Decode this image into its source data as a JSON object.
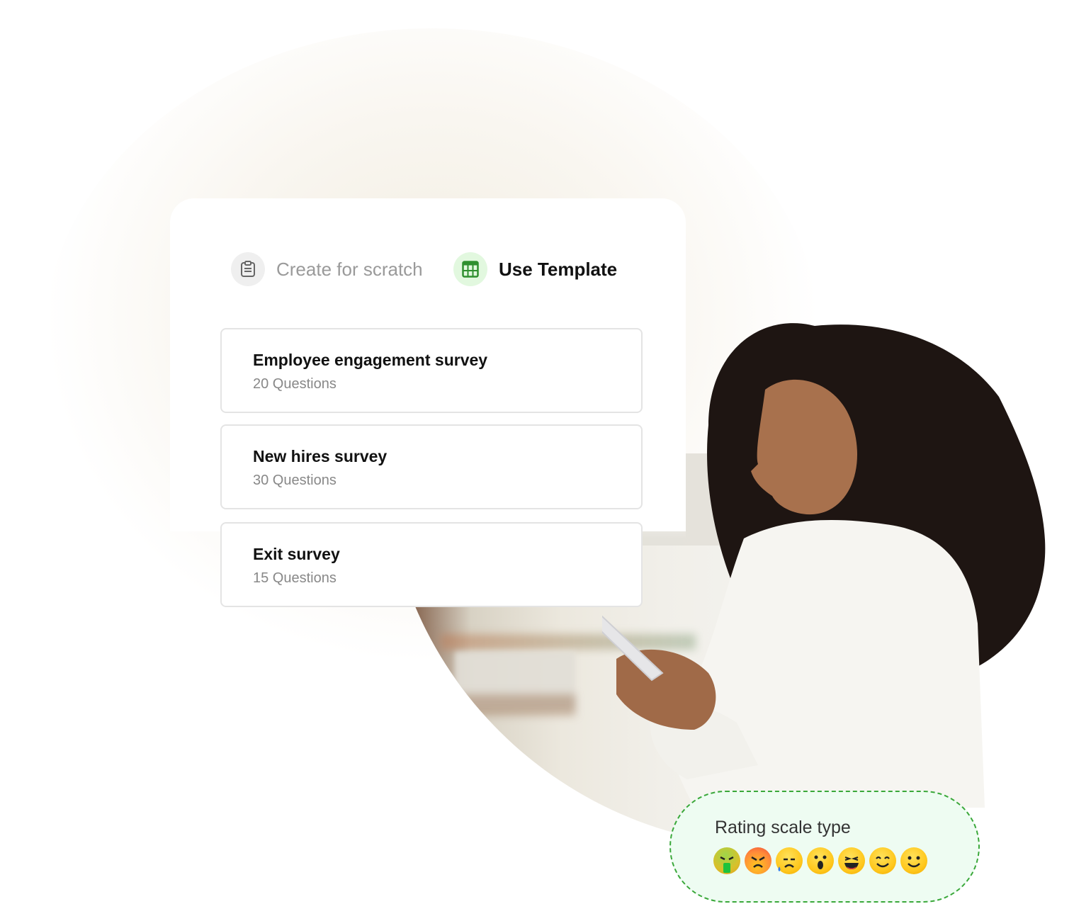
{
  "tabs": [
    {
      "label": "Create for scratch",
      "icon": "clipboard-icon",
      "active": false
    },
    {
      "label": "Use Template",
      "icon": "table-grid-icon",
      "active": true
    }
  ],
  "templates": [
    {
      "title": "Employee engagement survey",
      "questions": "20 Questions"
    },
    {
      "title": "New hires survey",
      "questions": "30 Questions"
    },
    {
      "title": "Exit survey",
      "questions": "15 Questions"
    }
  ],
  "rating": {
    "title": "Rating scale type",
    "emojis": [
      "nauseated-face-icon",
      "angry-face-icon",
      "sad-tear-face-icon",
      "surprised-face-icon",
      "grinning-face-icon",
      "smiling-eyes-face-icon",
      "slight-smile-face-icon"
    ]
  },
  "colors": {
    "accent": "#3aa83a",
    "active_icon_bg": "#e2f8df",
    "rating_bg": "#eefcf2"
  }
}
